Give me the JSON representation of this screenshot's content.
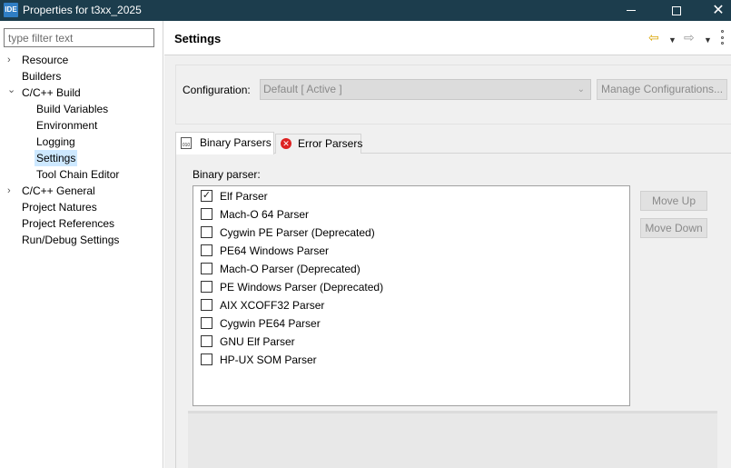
{
  "window": {
    "icon_text": "IDE",
    "title": "Properties for t3xx_2025",
    "close_glyph": "✕"
  },
  "filter": {
    "placeholder": "type filter text"
  },
  "tree": {
    "expanded_glyph": "⌄",
    "collapsed_glyph": "›",
    "items": [
      {
        "label": "Resource",
        "level": 0,
        "state": "collapsed"
      },
      {
        "label": "Builders",
        "level": 0,
        "state": "leaf"
      },
      {
        "label": "C/C++ Build",
        "level": 0,
        "state": "expanded"
      },
      {
        "label": "Build Variables",
        "level": 1,
        "state": "leaf"
      },
      {
        "label": "Environment",
        "level": 1,
        "state": "leaf"
      },
      {
        "label": "Logging",
        "level": 1,
        "state": "leaf"
      },
      {
        "label": "Settings",
        "level": 1,
        "state": "leaf",
        "selected": true
      },
      {
        "label": "Tool Chain Editor",
        "level": 1,
        "state": "leaf"
      },
      {
        "label": "C/C++ General",
        "level": 0,
        "state": "collapsed"
      },
      {
        "label": "Project Natures",
        "level": 0,
        "state": "leaf"
      },
      {
        "label": "Project References",
        "level": 0,
        "state": "leaf"
      },
      {
        "label": "Run/Debug Settings",
        "level": 0,
        "state": "leaf"
      }
    ]
  },
  "header": {
    "title": "Settings",
    "back_glyph": "⇦",
    "forward_glyph": "⇨",
    "dropdown_glyph": "▼"
  },
  "config": {
    "label": "Configuration:",
    "value": "Default  [ Active ]",
    "dropdown_glyph": "⌄",
    "manage_label": "Manage Configurations..."
  },
  "tabs": {
    "binary": {
      "label": "Binary Parsers",
      "icon_text": "010"
    },
    "error": {
      "label": "Error Parsers",
      "icon_text": "✕"
    }
  },
  "parsers": {
    "label": "Binary parser:",
    "check_glyph": "✓",
    "items": [
      {
        "label": "Elf Parser",
        "checked": true
      },
      {
        "label": "Mach-O 64 Parser",
        "checked": false
      },
      {
        "label": "Cygwin PE Parser (Deprecated)",
        "checked": false
      },
      {
        "label": "PE64 Windows Parser",
        "checked": false
      },
      {
        "label": "Mach-O Parser (Deprecated)",
        "checked": false
      },
      {
        "label": "PE Windows Parser (Deprecated)",
        "checked": false
      },
      {
        "label": "AIX XCOFF32 Parser",
        "checked": false
      },
      {
        "label": "Cygwin PE64 Parser",
        "checked": false
      },
      {
        "label": "GNU Elf Parser",
        "checked": false
      },
      {
        "label": "HP-UX SOM Parser",
        "checked": false
      }
    ],
    "move_up_label": "Move Up",
    "move_down_label": "Move Down"
  }
}
